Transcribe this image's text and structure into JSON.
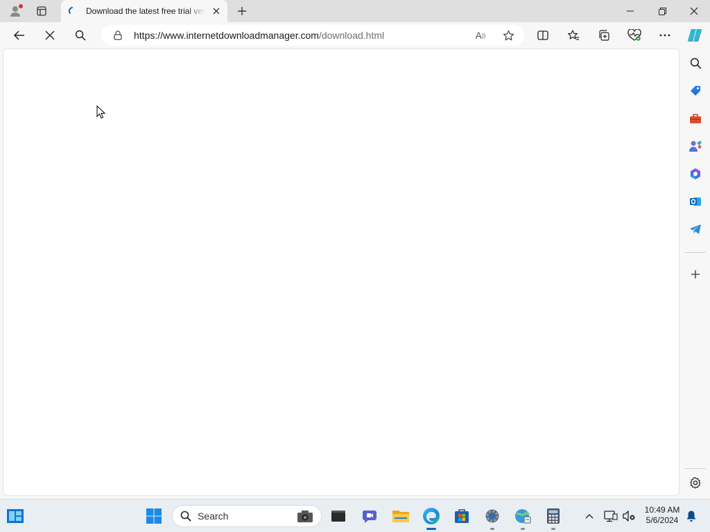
{
  "browser": {
    "tab": {
      "title": "Download the latest free trial version of Internet Download Manager"
    },
    "new_tab_symbol": "+",
    "window_controls": [
      "minimize-icon",
      "restore-icon",
      "close-icon"
    ]
  },
  "toolbar": {
    "url_host": "https://www.internetdownloadmanager.com",
    "url_path": "/download.html",
    "read_aloud_label": "A",
    "icons": [
      "back-icon",
      "stop-loading-icon",
      "search-icon",
      "lock-icon",
      "read-aloud-icon",
      "favorite-star-icon",
      "split-screen-icon",
      "favorites-icon",
      "collections-icon",
      "browser-essentials-icon",
      "more-icon",
      "copilot-icon"
    ]
  },
  "sidebar": {
    "icons": [
      "search-icon",
      "shopping-tag-icon",
      "tools-icon",
      "games-icon",
      "microsoft-365-icon",
      "outlook-icon",
      "telegram-icon",
      "add-icon",
      "settings-icon"
    ]
  },
  "taskbar": {
    "search_placeholder": "Search",
    "apps": [
      "widgets-icon",
      "start-icon",
      "camera-icon",
      "terminal-icon",
      "teams-icon",
      "file-explorer-icon",
      "edge-icon",
      "store-icon",
      "settings-app-icon",
      "network-app-icon",
      "calculator-icon"
    ],
    "time": "10:49 AM",
    "date": "5/6/2024"
  },
  "colors": {
    "accent": "#0067c0",
    "notification_badge": "#d13438"
  }
}
